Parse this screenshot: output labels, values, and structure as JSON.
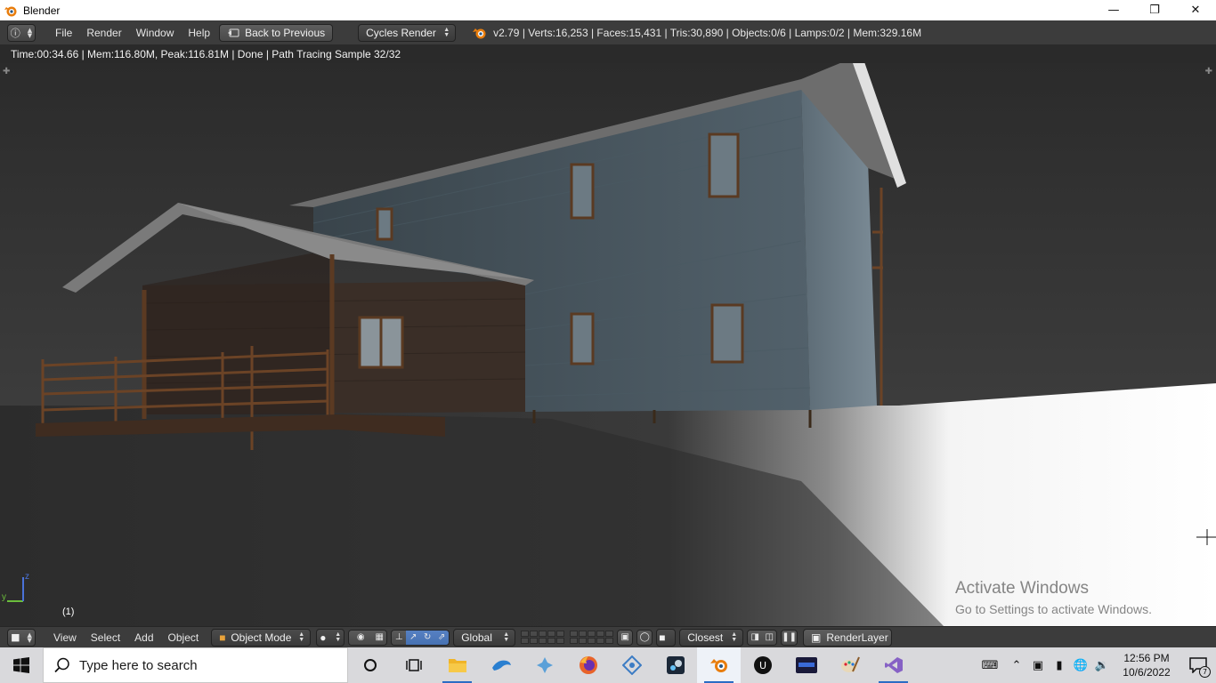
{
  "window": {
    "title": "Blender",
    "controls": [
      "minimize-icon",
      "maximize-icon",
      "close-icon"
    ]
  },
  "info_header": {
    "menus": [
      "File",
      "Render",
      "Window",
      "Help"
    ],
    "back_button": "Back to Previous",
    "render_engine": "Cycles Render",
    "stats": "v2.79 | Verts:16,253 | Faces:15,431 | Tris:30,890 | Objects:0/6 | Lamps:0/2 | Mem:329.16M"
  },
  "render_status": "Time:00:34.66 | Mem:116.80M, Peak:116.81M | Done | Path Tracing Sample 32/32",
  "viewport": {
    "frame_label": "(1)",
    "axis_labels": {
      "x": "x",
      "y": "y",
      "z": "z"
    },
    "watermark_title": "Activate Windows",
    "watermark_sub": "Go to Settings to activate Windows."
  },
  "view_header": {
    "menus": [
      "View",
      "Select",
      "Add",
      "Object"
    ],
    "mode": "Object Mode",
    "orientation": "Global",
    "snap_target": "Closest",
    "render_layer": "RenderLayer"
  },
  "taskbar": {
    "search_placeholder": "Type here to search",
    "apps": [
      "cortana-icon",
      "task-view-icon",
      "file-explorer-icon",
      "dolphin-icon",
      "app-icon",
      "firefox-icon",
      "app-icon",
      "steam-icon",
      "blender-icon",
      "unreal-engine-icon",
      "app-icon",
      "paint-icon",
      "visual-studio-icon"
    ],
    "time": "12:56 PM",
    "date": "10/6/2022",
    "notification_count": "7"
  },
  "colors": {
    "header_bg": "#3c3c3c",
    "active_blue": "#5680c2",
    "blender_orange": "#e87d0d",
    "taskbar_bg": "#d9d9dc"
  }
}
